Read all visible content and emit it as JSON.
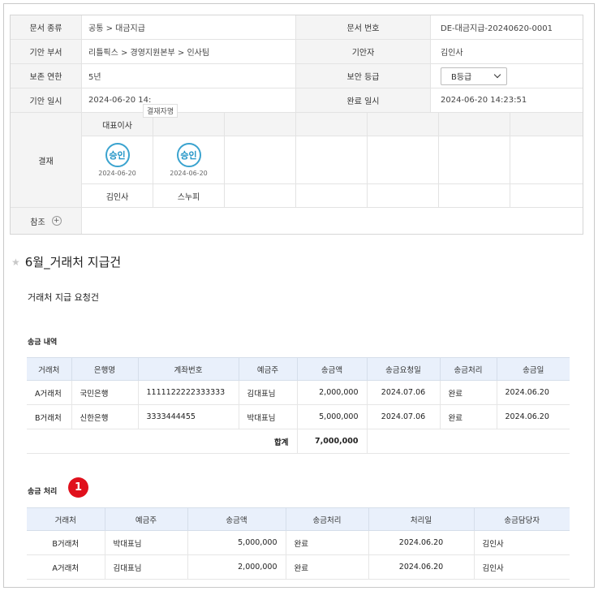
{
  "doc": {
    "type_label": "문서 종류",
    "type_value": "공통 > 대금지급",
    "no_label": "문서 번호",
    "no_value": "DE-대금지급-20240620-0001",
    "dept_label": "기안 부서",
    "dept_value": "리틀픽스 > 경영지원본부 > 인사팀",
    "drafter_label": "기안자",
    "drafter_value": "김인사",
    "retention_label": "보존 연한",
    "retention_value": "5년",
    "security_label": "보안 등급",
    "security_value": "B등급",
    "draft_date_label": "기안 일시",
    "draft_date_value": "2024-06-20 14:",
    "done_date_label": "완료 일시",
    "done_date_value": "2024-06-20 14:23:51"
  },
  "approval": {
    "label": "결재",
    "tooltip": "결재자명",
    "approvers": [
      {
        "role": "대표이사",
        "stamp": "승인",
        "date": "2024-06-20",
        "name": "김인사"
      },
      {
        "role": "",
        "stamp": "승인",
        "date": "2024-06-20",
        "name": "스누피"
      }
    ],
    "reference_label": "참조"
  },
  "title": "6월_거래처 지급건",
  "subtitle": "거래처 지급 요청건",
  "remit": {
    "section_label": "송금 내역",
    "headers": [
      "거래처",
      "은행명",
      "계좌번호",
      "예금주",
      "송금액",
      "송금요청일",
      "송금처리",
      "송금일"
    ],
    "rows": [
      [
        "A거래처",
        "국민은행",
        "1111122222333333",
        "김대표님",
        "2,000,000",
        "2024.07.06",
        "완료",
        "2024.06.20"
      ],
      [
        "B거래처",
        "신한은행",
        "3333444455",
        "박대표님",
        "5,000,000",
        "2024.07.06",
        "완료",
        "2024.06.20"
      ]
    ],
    "total_label": "합계",
    "total_value": "7,000,000"
  },
  "process": {
    "section_label": "송금 처리",
    "badge": "1",
    "headers": [
      "거래처",
      "예금주",
      "송금액",
      "송금처리",
      "처리일",
      "송금담당자"
    ],
    "rows": [
      [
        "B거래처",
        "박대표님",
        "5,000,000",
        "완료",
        "2024.06.20",
        "김인사"
      ],
      [
        "A거래처",
        "김대표님",
        "2,000,000",
        "완료",
        "2024.06.20",
        "김인사"
      ]
    ]
  }
}
